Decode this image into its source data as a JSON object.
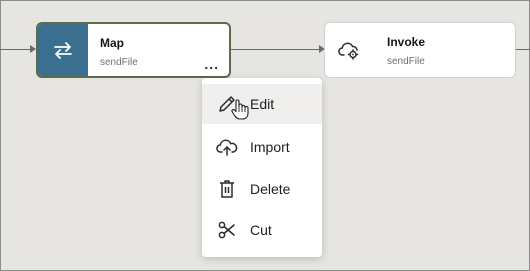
{
  "canvas": {
    "nodes": [
      {
        "title": "Map",
        "subtitle": "sendFile",
        "icon": "swap-arrows-icon",
        "selected": true,
        "more_label": "..."
      },
      {
        "title": "Invoke",
        "subtitle": "sendFile",
        "icon": "cloud-gear-icon",
        "selected": false
      }
    ]
  },
  "context_menu": {
    "items": [
      {
        "label": "Edit",
        "icon": "pencil-icon",
        "hovered": true
      },
      {
        "label": "Import",
        "icon": "cloud-upload-icon"
      },
      {
        "label": "Delete",
        "icon": "trash-icon"
      },
      {
        "label": "Cut",
        "icon": "scissors-icon"
      }
    ]
  },
  "colors": {
    "canvas_bg": "#e7e5e2",
    "node_icon_bg": "#3a6f8f",
    "selected_border": "#5d6b48",
    "connector": "#6b6b6b"
  }
}
